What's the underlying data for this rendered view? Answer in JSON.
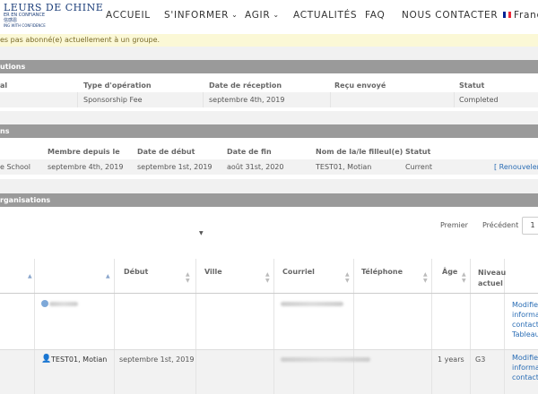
{
  "brand": {
    "name": "LEURS DE CHINE",
    "tagline_fr": "ER EN CONFIANCE",
    "tagline_zh": "信感恩",
    "tagline_en": "ING WITH CONFIDENCE"
  },
  "nav": {
    "items": [
      {
        "label": "ACCUEIL"
      },
      {
        "label": "S'INFORMER"
      },
      {
        "label": "AGIR"
      },
      {
        "label": "ACTUALITÉS"
      },
      {
        "label": "FAQ"
      },
      {
        "label": "NOUS CONTACTER"
      },
      {
        "label": "Franç"
      }
    ]
  },
  "notice": {
    "text": "es pas abonné(e) actuellement à un groupe."
  },
  "contributions": {
    "title": "utions",
    "headers": [
      "al",
      "Type d'opération",
      "Date de réception",
      "Reçu envoyé",
      "Statut"
    ],
    "rows": [
      [
        "",
        "Sponsorship Fee",
        "septembre 4th, 2019",
        "",
        "Completed"
      ]
    ]
  },
  "memberships": {
    "title": "ns",
    "headers": [
      "Membre depuis le",
      "Date de début",
      "Date de fin",
      "Nom de la/le filleul(e)",
      "Statut"
    ],
    "row": {
      "type": "e School",
      "since": "septembre 4th, 2019",
      "start": "septembre 1st, 2019",
      "end": "août 31st, 2020",
      "name": "TEST01, Motian",
      "status": "Current",
      "renew": "[ Renouveler"
    }
  },
  "organisations": {
    "title": "rganisations",
    "pager": {
      "first": "Premier",
      "previous": "Précédent",
      "page": "1"
    },
    "headers": {
      "start": "Début",
      "city": "Ville",
      "email": "Courriel",
      "phone": "Téléphone",
      "age": "Âge",
      "level": "Niveau actuel"
    },
    "rows": [
      {
        "name": "",
        "start": "",
        "age": "",
        "level": "",
        "actions": [
          "Modifier",
          "informat",
          "contact",
          "Tableau"
        ]
      },
      {
        "name": "TEST01, Motian",
        "start": "septembre 1st, 2019",
        "age": "1 years",
        "level": "G3",
        "actions": [
          "Modifier",
          "informat",
          "contact"
        ]
      }
    ]
  },
  "colors": {
    "panel_header": "#9a9a9a",
    "link": "#2a6db5",
    "notice_bg": "#fbf8d6"
  }
}
